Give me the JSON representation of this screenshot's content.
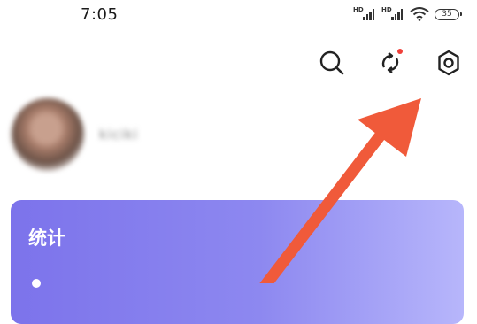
{
  "status_bar": {
    "time": "7:05",
    "signal_1_label": "HD",
    "signal_2_label": "HD",
    "battery_level": "35",
    "icons": [
      "signal-icon",
      "signal-icon",
      "wifi-icon",
      "battery-icon"
    ]
  },
  "toolbar": {
    "icons": [
      "search-icon",
      "sync-icon",
      "settings-icon"
    ],
    "sync_has_notification": true,
    "notification_color": "#f0403a"
  },
  "profile": {
    "username": "kiciki"
  },
  "stats_card": {
    "title": "统计",
    "gradient_colors": [
      "#7c73eb",
      "#b7b6fb"
    ]
  },
  "annotation": {
    "arrow_color": "#f05a3a",
    "points_to": "settings-icon"
  }
}
